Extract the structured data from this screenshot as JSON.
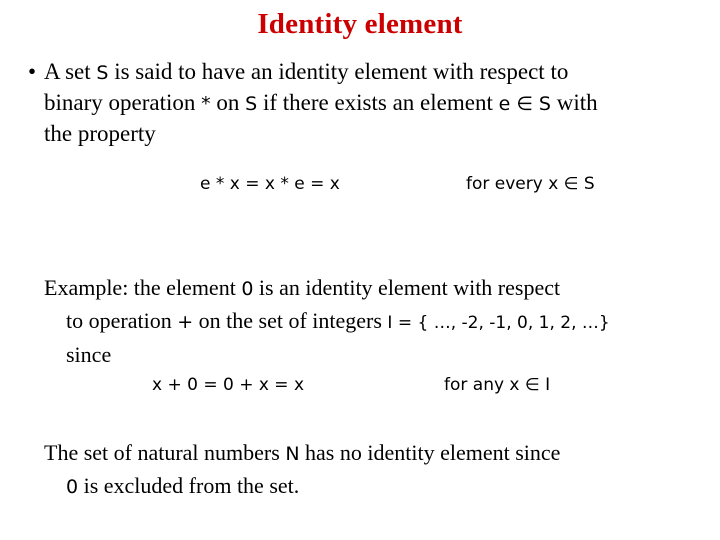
{
  "slide": {
    "title": "Identity element",
    "bullet": {
      "marker": "•",
      "line1_a": "A set ",
      "line1_set": "S",
      "line1_b": " is said to have an identity element with respect to",
      "line2_a": "binary operation ",
      "line2_op": "*",
      "line2_b": " on ",
      "line2_set": "S",
      "line2_c": " if there exists an element ",
      "line2_elem": "e ∈ S",
      "line2_d": " with",
      "line3": "the property"
    },
    "equation1": {
      "left": "e * x = x * e = x",
      "right": "for every  x ∈ S"
    },
    "example": {
      "part1_a": "Example: the element ",
      "part1_zero": "0",
      "part1_b": " is an identity element with respect",
      "part2_a": "to operation ",
      "part2_op": "+",
      "part2_b": " on the set of integers ",
      "part2_set": "I = { …, -2, -1, 0, 1, 2, …}",
      "part3": "since"
    },
    "equation2": {
      "left": "x + 0  =  0 + x  =  x",
      "right": "for any  x ∈ I"
    },
    "final": {
      "line1_a": "The set of natural numbers ",
      "line1_n": "N",
      "line1_b": " has no identity element since",
      "line2_zero": "0",
      "line2_b": " is excluded from the set."
    },
    "colors": {
      "title": "#cc0000",
      "body": "#000000",
      "background": "#ffffff"
    }
  }
}
